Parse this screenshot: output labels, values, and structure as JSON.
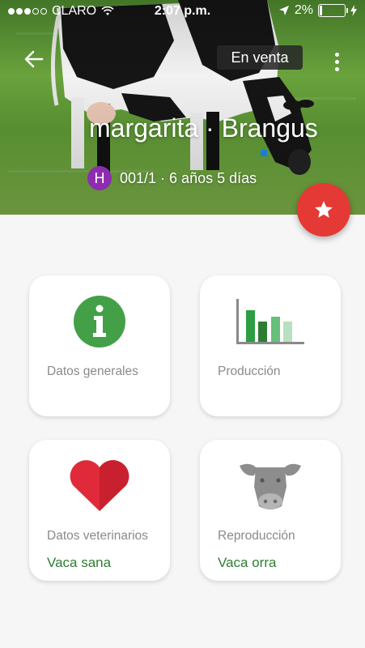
{
  "status_bar": {
    "carrier": "CLARO",
    "time": "2:07 p.m.",
    "battery_text": "2%",
    "battery_level": 0.02,
    "signal_bars_filled": 3,
    "signal_bars_total": 5
  },
  "header": {
    "sale_label": "En venta",
    "animal_name": "margarita · Brangus",
    "sex_badge": "H",
    "id_and_age": "001/1 · 6 años 5 días"
  },
  "cards": {
    "general": {
      "label": "Datos generales"
    },
    "production": {
      "label": "Producción"
    },
    "vet": {
      "label": "Datos veterinarios",
      "status": "Vaca sana"
    },
    "repro": {
      "label": "Reproducción",
      "status": "Vaca orra"
    }
  },
  "colors": {
    "accent_green": "#43a047",
    "status_green": "#2e7d32",
    "fab_red": "#e53935",
    "heart_red": "#e02a3a",
    "badge_purple": "#8e2cb0"
  }
}
